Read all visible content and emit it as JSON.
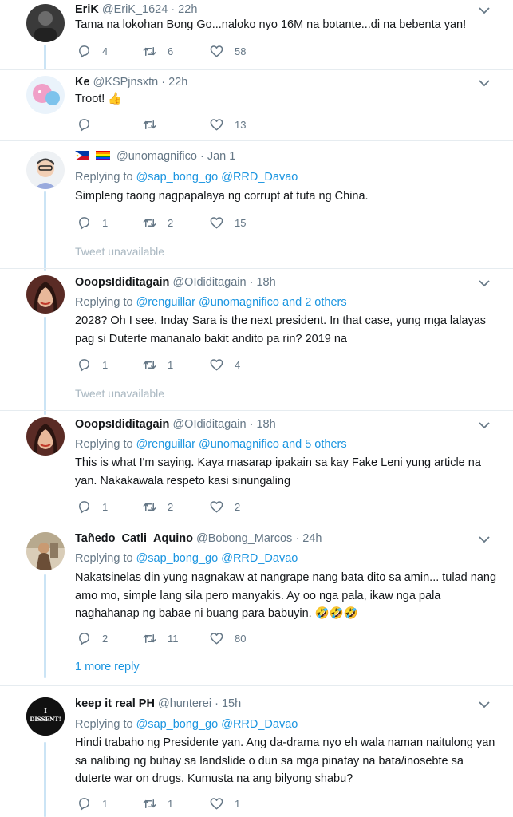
{
  "tweets": [
    {
      "name": "EriK",
      "handle": "@EriK_1624",
      "date": "· 22h",
      "text": "Tama na lokohan Bong Go...naloko nyo 16M na botante...di na bebenta yan!",
      "replies": "4",
      "retweets": "6",
      "likes": "58"
    },
    {
      "name": "Ke",
      "handle": "@KSPjnsxtn",
      "date": "· 22h",
      "text": "Troot! 👍",
      "replies": "",
      "retweets": "",
      "likes": "13"
    },
    {
      "handle": "@unomagnifico",
      "date": "· Jan 1",
      "replying_prefix": "Replying to",
      "replying_users": "@sap_bong_go @RRD_Davao",
      "text": "Simpleng taong nagpapalaya ng corrupt at tuta ng China.",
      "replies": "1",
      "retweets": "2",
      "likes": "15"
    },
    {
      "name": "OoopsIdiditagain",
      "handle": "@OIdiditagain",
      "date": "· 18h",
      "replying_prefix": "Replying to",
      "replying_users": "@renguillar @unomagnifico",
      "replying_suffix": "and 2 others",
      "text": "2028? Oh I see. Inday Sara is the next president. In that case, yung mga lalayas pag si Duterte mananalo bakit andito pa rin? 2019 na",
      "replies": "1",
      "retweets": "1",
      "likes": "4"
    },
    {
      "name": "OoopsIdiditagain",
      "handle": "@OIdiditagain",
      "date": "· 18h",
      "replying_prefix": "Replying to",
      "replying_users": "@renguillar @unomagnifico",
      "replying_suffix": "and 5 others",
      "text": "This is what I'm saying. Kaya masarap ipakain sa kay Fake Leni yung article na yan. Nakakawala respeto kasi sinungaling",
      "replies": "1",
      "retweets": "2",
      "likes": "2"
    },
    {
      "name": "Tañedo_Catli_Aquino",
      "handle": "@Bobong_Marcos",
      "date": "· 24h",
      "replying_prefix": "Replying to",
      "replying_users": "@sap_bong_go @RRD_Davao",
      "text": "Nakatsinelas din yung nagnakaw at nangrape nang bata dito sa amin... tulad nang amo mo, simple lang sila pero manyakis. Ay oo nga pala, ikaw nga pala naghahanap ng babae ni buang para babuyin. 🤣🤣🤣",
      "replies": "2",
      "retweets": "11",
      "likes": "80"
    },
    {
      "name": "keep it real PH",
      "handle": "@hunterei",
      "date": "· 15h",
      "replying_prefix": "Replying to",
      "replying_users": "@sap_bong_go @RRD_Davao",
      "text": "Hindi trabaho ng Presidente yan. Ang da-drama nyo eh wala naman naitulong yan sa nalibing ng buhay sa landslide o dun sa mga pinatay na bata/inosebte sa duterte war on drugs. Kumusta na ang bilyong shabu?",
      "replies": "1",
      "retweets": "1",
      "likes": "1"
    }
  ],
  "tweet_unavailable": "Tweet unavailable",
  "more_reply": "1 more reply",
  "dissent_avatar": {
    "line1": "I",
    "line2": "DISSENT!"
  },
  "icons": {
    "reply": "reply-icon",
    "retweet": "retweet-icon",
    "like": "heart-icon",
    "menu": "chevron-down-icon"
  },
  "colors": {
    "link": "#1b95e0",
    "muted": "#657786",
    "thread": "#cbe4f5",
    "separator": "#e6ecf0"
  }
}
